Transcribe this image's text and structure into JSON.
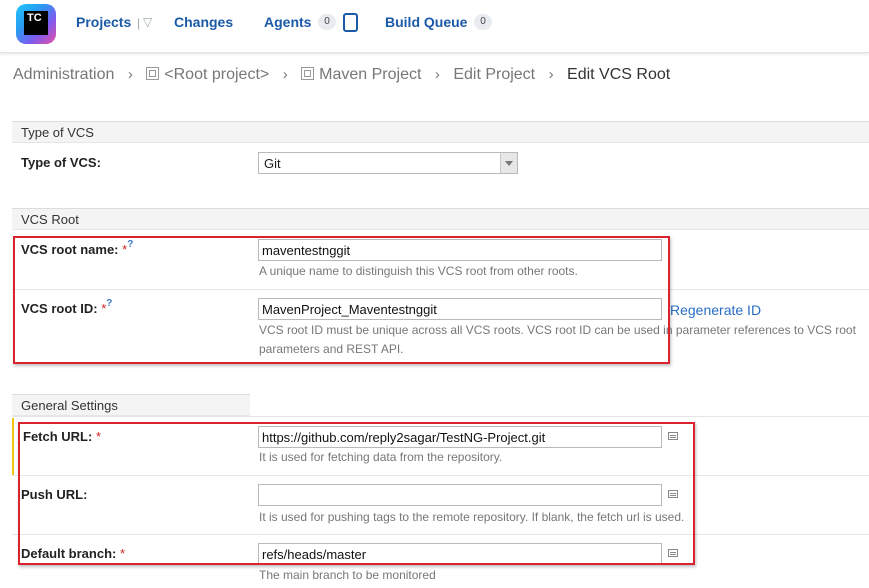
{
  "nav": {
    "logo_text": "TC",
    "projects": "Projects",
    "changes": "Changes",
    "agents": "Agents",
    "agents_count": "0",
    "build_queue": "Build Queue",
    "build_queue_count": "0"
  },
  "breadcrumb": {
    "administration": "Administration",
    "root_project": "<Root project>",
    "maven_project": "Maven Project",
    "edit_project": "Edit Project",
    "current": "Edit VCS Root"
  },
  "type_section": {
    "title": "Type of VCS",
    "label": "Type of VCS:",
    "value": "Git"
  },
  "vcs_root_section": {
    "title": "VCS Root",
    "name_label": "VCS root name:",
    "name_value": "maventestnggit",
    "name_note": "A unique name to distinguish this VCS root from other roots.",
    "id_label": "VCS root ID:",
    "id_value": "MavenProject_Maventestnggit",
    "regenerate_link": "Regenerate ID",
    "id_note_line1": "VCS root ID must be unique across all VCS roots. VCS root ID can be used in parameter references to VCS root",
    "id_note_line2": "parameters and REST API."
  },
  "general_section": {
    "title": "General Settings",
    "fetch_label": "Fetch URL:",
    "fetch_value": "https://github.com/reply2sagar/TestNG-Project.git",
    "fetch_note": "It is used for fetching data from the repository.",
    "push_label": "Push URL:",
    "push_value": "",
    "push_note": "It is used for pushing tags to the remote repository. If blank, the fetch url is used.",
    "branch_label": "Default branch:",
    "branch_value": "refs/heads/master",
    "branch_note": "The main branch to be monitored"
  },
  "required_marker": "*",
  "help_marker": "?"
}
